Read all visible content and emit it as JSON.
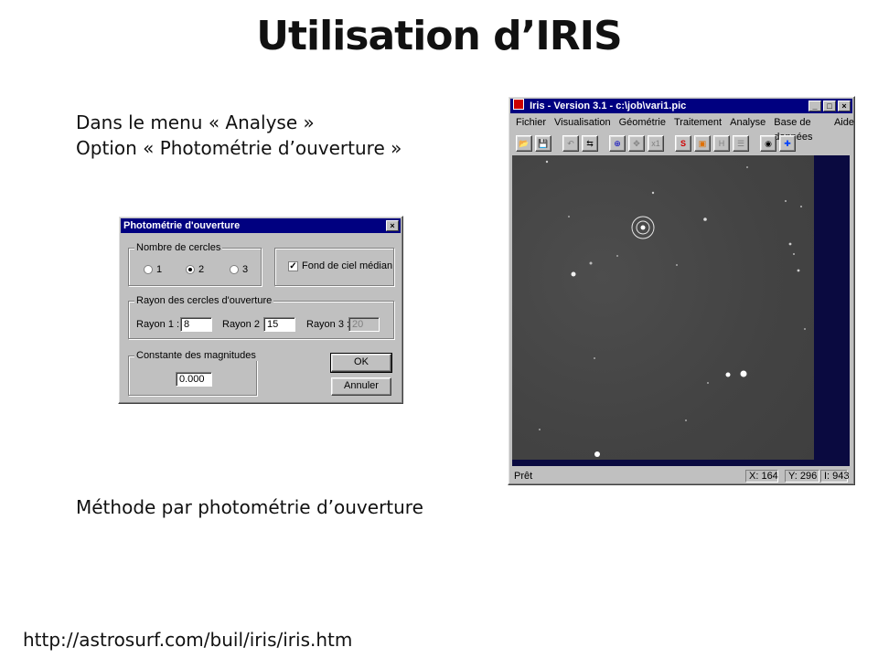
{
  "slide": {
    "title": "Utilisation d’IRIS",
    "intro_line1": "Dans le menu « Analyse »",
    "intro_line2": "Option « Photométrie d’ouverture »",
    "caption": "Méthode par photométrie d’ouverture",
    "footer_link": "http://astrosurf.com/buil/iris/iris.htm"
  },
  "dialog": {
    "title": "Photométrie d'ouverture",
    "close_glyph": "×",
    "circles_group": "Nombre de cercles",
    "radio_options": [
      "1",
      "2",
      "3"
    ],
    "radio_selected": "2",
    "median_sky_label": "Fond de ciel médian",
    "median_sky_checked": true,
    "check_mark": "✓",
    "radius_group": "Rayon des cercles d'ouverture",
    "radius1_label": "Rayon 1 :",
    "radius1_value": "8",
    "radius2_label": "Rayon 2 :",
    "radius2_value": "15",
    "radius3_label": "Rayon 3 :",
    "radius3_value": "20",
    "magnitude_group": "Constante des magnitudes",
    "magnitude_value": "0.000",
    "ok_label": "OK",
    "cancel_label": "Annuler"
  },
  "iris": {
    "title": "Iris - Version 3.1 - c:\\job\\vari1.pic",
    "win_buttons": [
      "_",
      "□",
      "×"
    ],
    "menu": [
      "Fichier",
      "Visualisation",
      "Géométrie",
      "Traitement",
      "Analyse",
      "Base de données",
      "Aide"
    ],
    "toolbar": [
      {
        "name": "open-folder-icon",
        "glyph": "📂"
      },
      {
        "name": "save-disk-icon",
        "glyph": "💾"
      },
      {
        "name": "undo-icon",
        "glyph": "↶"
      },
      {
        "name": "swap-icon",
        "glyph": "⇆"
      },
      {
        "name": "crosshair-icon",
        "glyph": "⊕"
      },
      {
        "name": "move-icon",
        "glyph": "✥"
      },
      {
        "name": "zoom-x1-icon",
        "glyph": "x1"
      },
      {
        "name": "red-circle-icon",
        "glyph": "S"
      },
      {
        "name": "orange-square-icon",
        "glyph": "▣"
      },
      {
        "name": "histogram-icon",
        "glyph": "H"
      },
      {
        "name": "list-icon",
        "glyph": "☰"
      },
      {
        "name": "camera-icon",
        "glyph": "◉"
      },
      {
        "name": "blue-cross-icon",
        "glyph": "✚"
      }
    ],
    "status": "Prêt",
    "x": "X: 164",
    "y": "Y: 296",
    "i": "I: 943"
  }
}
